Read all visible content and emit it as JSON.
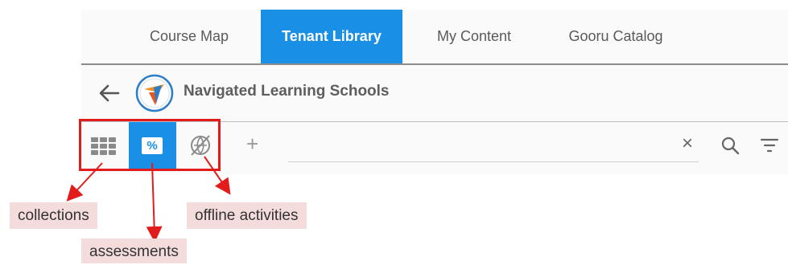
{
  "tabs": [
    {
      "label": "Course Map"
    },
    {
      "label": "Tenant Library"
    },
    {
      "label": "My Content"
    },
    {
      "label": "Gooru Catalog"
    }
  ],
  "header": {
    "school_name": "Navigated Learning Schools"
  },
  "toolbar": {
    "assessment_symbol": "%",
    "add_symbol": "+",
    "clear_symbol": "×"
  },
  "annotations": {
    "collections": "collections",
    "assessments": "assessments",
    "offline_activities": "offline activities"
  },
  "colors": {
    "accent": "#1a8fe6",
    "annotation_red": "#e21b1b",
    "callout_bg": "#f5dcdc"
  }
}
